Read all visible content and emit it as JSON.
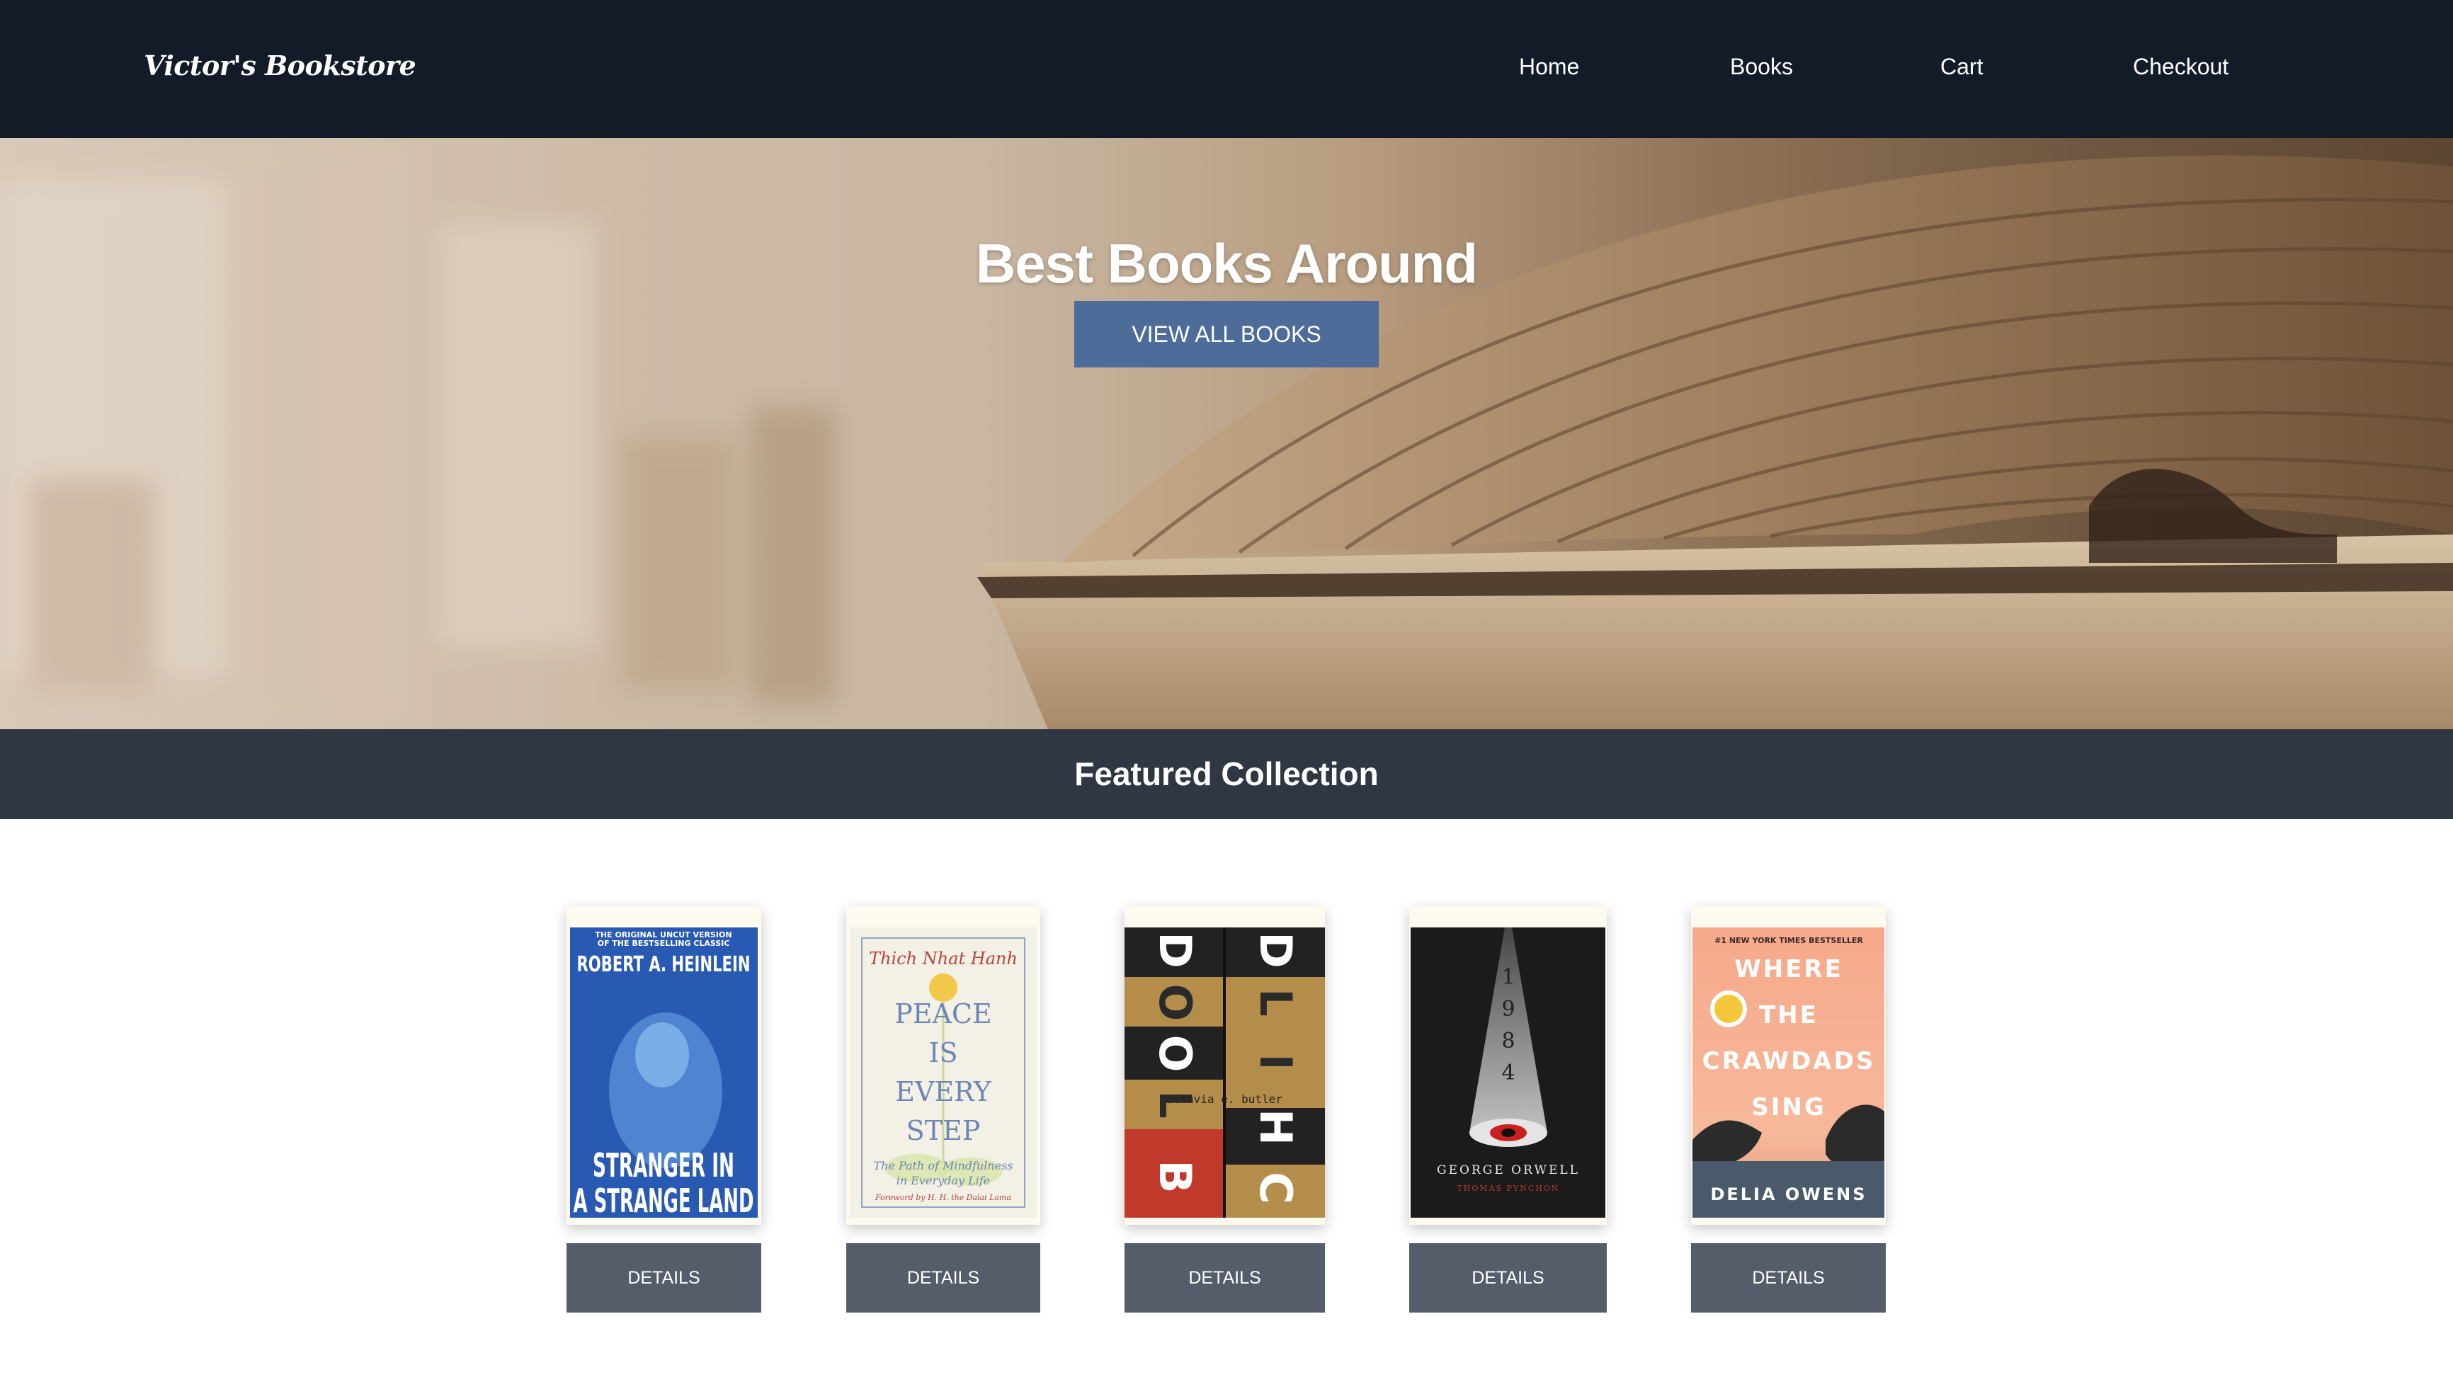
{
  "navbar": {
    "brand": "Victor's Bookstore",
    "links": [
      "Home",
      "Books",
      "Cart",
      "Checkout"
    ]
  },
  "hero": {
    "title": "Best Books Around",
    "button_label": "VIEW ALL BOOKS"
  },
  "featured": {
    "title": "Featured Collection"
  },
  "books": [
    {
      "cover_lines": [
        "THE ORIGINAL UNCUT VERSION",
        "OF THE BESTSELLING CLASSIC",
        "ROBERT A. HEINLEIN",
        "STRANGER IN",
        "A STRANGE LAND"
      ],
      "details_label": "DETAILS"
    },
    {
      "cover_lines": [
        "Thich Nhat Hanh",
        "PEACE",
        "IS",
        "EVERY",
        "STEP",
        "The Path of Mindfulness",
        "in Everyday Life",
        "Foreword by H. H. the Dalai Lama"
      ],
      "details_label": "DETAILS"
    },
    {
      "cover_lines": [
        "D",
        "O",
        "O",
        "L",
        "B",
        "D",
        "L",
        "I",
        "H",
        "C",
        "octavia e. butler"
      ],
      "details_label": "DETAILS"
    },
    {
      "cover_lines": [
        "1",
        "9",
        "8",
        "4",
        "GEORGE ORWELL",
        "THOMAS PYNCHON"
      ],
      "details_label": "DETAILS"
    },
    {
      "cover_lines": [
        "#1 NEW YORK TIMES BESTSELLER",
        "WHERE",
        "THE",
        "CRAWDADS",
        "SING",
        "DELIA OWENS"
      ],
      "details_label": "DETAILS"
    }
  ],
  "colors": {
    "navbar": "#131b29",
    "hero_button": "#4d6c99",
    "featured_bar": "#2f3743",
    "details_button": "#545d69"
  }
}
